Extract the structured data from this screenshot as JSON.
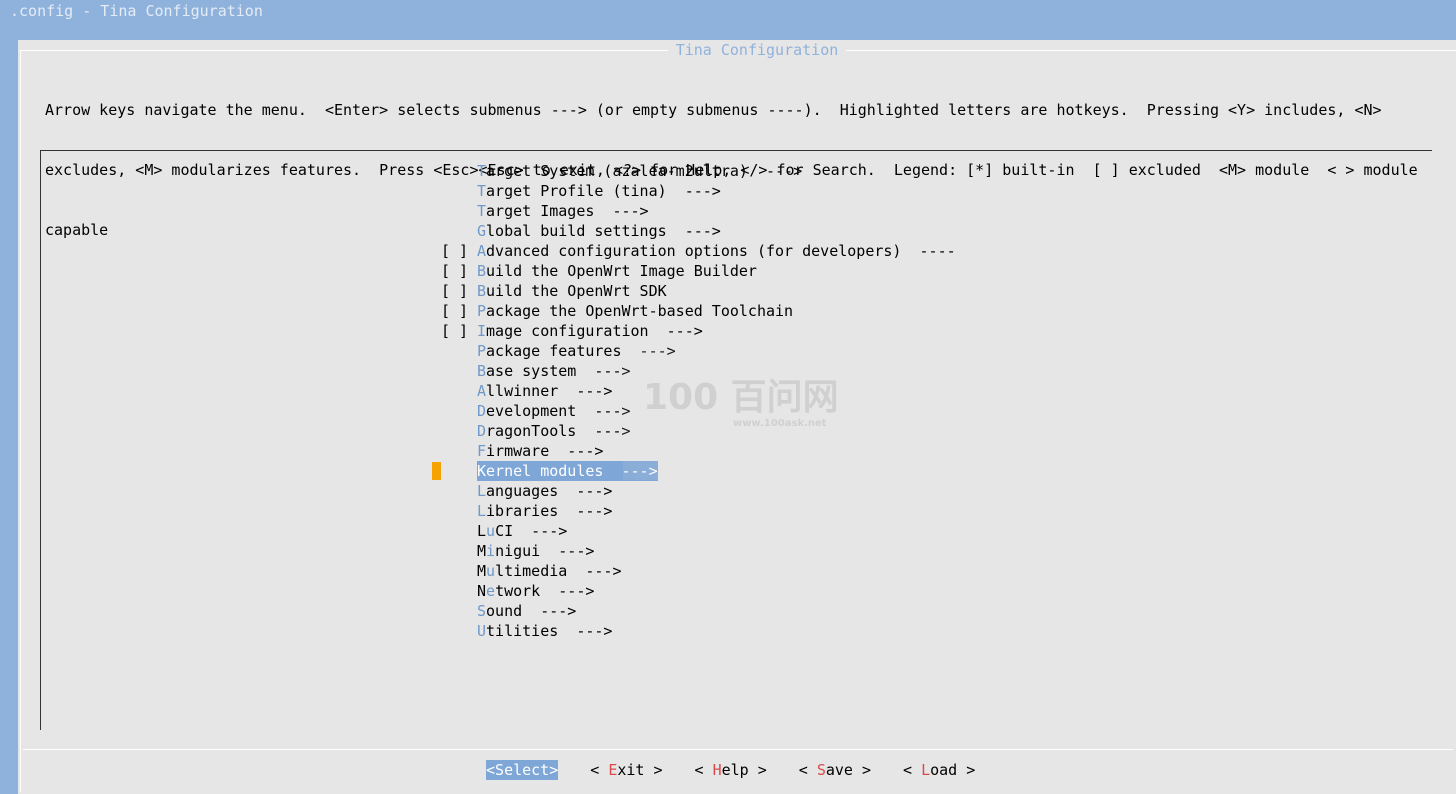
{
  "window": {
    "title": ".config - Tina Configuration"
  },
  "dialog": {
    "title": "Tina Configuration",
    "help_lines": [
      "Arrow keys navigate the menu.  <Enter> selects submenus ---> (or empty submenus ----).  Highlighted letters are hotkeys.  Pressing <Y> includes, <N>",
      "excludes, <M> modularizes features.  Press <Esc><Esc> to exit, <?> for Help, </> for Search.  Legend: [*] built-in  [ ] excluded  <M> module  < > module",
      "capable"
    ]
  },
  "menu": {
    "selected_index": 15,
    "items": [
      {
        "mark": "",
        "hot": "T",
        "rest": "arget System (azalea-m2ultra)  --->"
      },
      {
        "mark": "",
        "hot": "T",
        "rest": "arget Profile (tina)  --->"
      },
      {
        "mark": "",
        "hot": "T",
        "rest": "arget Images  --->"
      },
      {
        "mark": "",
        "hot": "G",
        "rest": "lobal build settings  --->"
      },
      {
        "mark": "[ ]",
        "hot": "A",
        "rest": "dvanced configuration options (for developers)  ----"
      },
      {
        "mark": "[ ]",
        "hot": "B",
        "rest": "uild the OpenWrt Image Builder"
      },
      {
        "mark": "[ ]",
        "hot": "B",
        "rest": "uild the OpenWrt SDK"
      },
      {
        "mark": "[ ]",
        "hot": "P",
        "rest": "ackage the OpenWrt-based Toolchain"
      },
      {
        "mark": "[ ]",
        "hot": "I",
        "rest": "mage configuration  --->"
      },
      {
        "mark": "",
        "hot": "P",
        "rest": "ackage features  --->"
      },
      {
        "mark": "",
        "hot": "B",
        "rest": "ase system  --->"
      },
      {
        "mark": "",
        "hot": "A",
        "rest": "llwinner  --->"
      },
      {
        "mark": "",
        "hot": "D",
        "rest": "evelopment  --->"
      },
      {
        "mark": "",
        "hot": "D",
        "rest": "ragonTools  --->"
      },
      {
        "mark": "",
        "hot": "F",
        "rest": "irmware  --->"
      },
      {
        "mark": "",
        "hot": "K",
        "rest": "ernel modules  --->"
      },
      {
        "mark": "",
        "hot": "L",
        "rest": "anguages  --->"
      },
      {
        "mark": "",
        "hot": "L",
        "rest": "ibraries  --->"
      },
      {
        "mark": "",
        "pre": "L",
        "hot": "u",
        "rest": "CI  --->"
      },
      {
        "mark": "",
        "pre": "M",
        "hot": "i",
        "rest": "nigui  --->"
      },
      {
        "mark": "",
        "pre": "M",
        "hot": "u",
        "rest": "ltimedia  --->"
      },
      {
        "mark": "",
        "pre": "N",
        "hot": "e",
        "rest": "twork  --->"
      },
      {
        "mark": "",
        "hot": "S",
        "rest": "ound  --->"
      },
      {
        "mark": "",
        "hot": "U",
        "rest": "tilities  --->"
      }
    ]
  },
  "buttons": [
    {
      "name": "select-button",
      "pre": "<",
      "hot": "S",
      "rest": "elect>",
      "selected": true
    },
    {
      "name": "exit-button",
      "pre": "< ",
      "hot": "E",
      "rest": "xit >",
      "selected": false
    },
    {
      "name": "help-button",
      "pre": "< ",
      "hot": "H",
      "rest": "elp >",
      "selected": false
    },
    {
      "name": "save-button",
      "pre": "< ",
      "hot": "S",
      "rest": "ave >",
      "selected": false
    },
    {
      "name": "load-button",
      "pre": "< ",
      "hot": "L",
      "rest": "oad >",
      "selected": false
    }
  ],
  "watermark": {
    "text": "100 百问网",
    "url": "www.100ask.net"
  },
  "colors": {
    "background": "#8fb2dc",
    "dialog": "#e6e6e6",
    "hotkey": "#6f99c9",
    "button_hotkey": "#d94b4b",
    "selection": "#7ea6d6",
    "cursor": "#f5a300"
  }
}
